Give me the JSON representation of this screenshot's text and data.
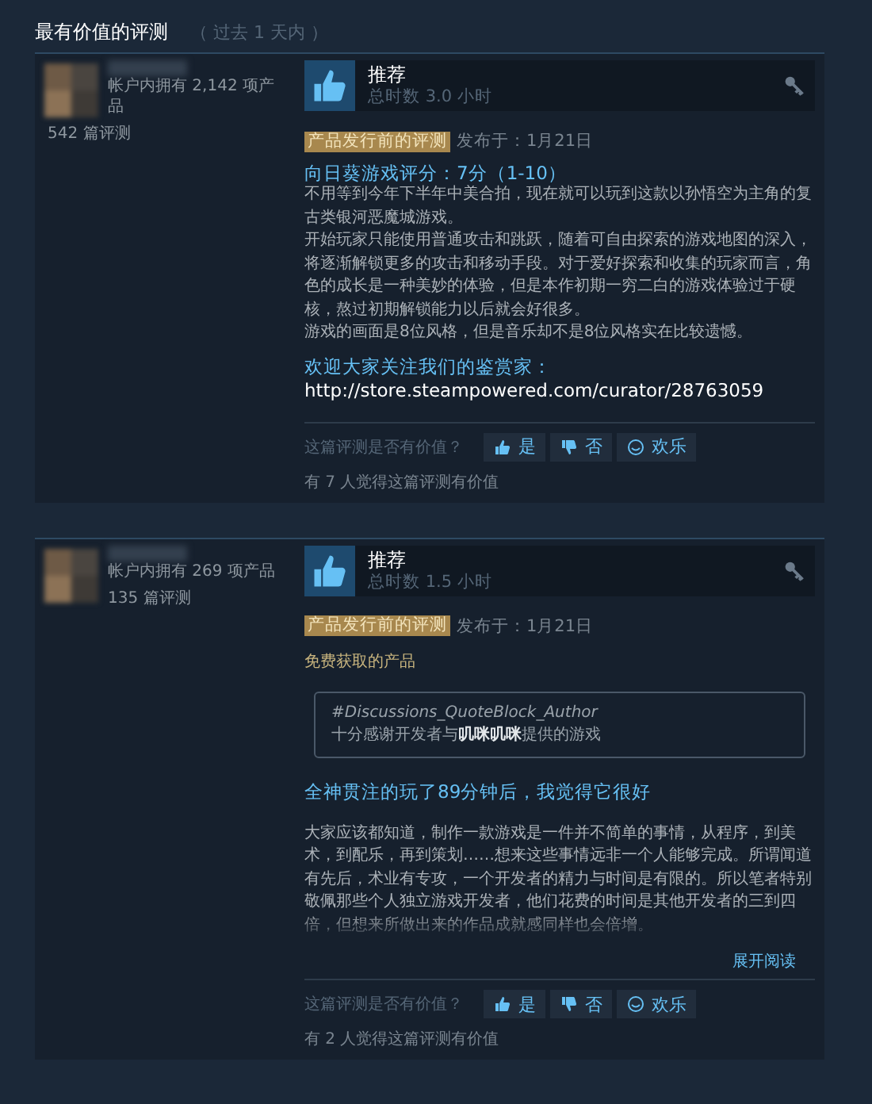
{
  "section": {
    "title": "最有价值的评测",
    "period": "（ 过去 1 天内 ）"
  },
  "reviews": [
    {
      "author": {
        "products": "帐户内拥有 2,142 项产品",
        "reviews": "542 篇评测"
      },
      "verdict": "推荐",
      "recommended": true,
      "hours": "总时数 3.0 小时",
      "tag": "产品发行前的评测",
      "posted": "发布于：1月21日",
      "blocks": [
        {
          "kind": "rating",
          "text": "向日葵游戏评分：7分（1-10）"
        },
        {
          "kind": "text",
          "text": "不用等到今年下半年中美合拍，现在就可以玩到这款以孙悟空为主角的复古类银河恶魔城游戏。"
        },
        {
          "kind": "text",
          "text": "开始玩家只能使用普通攻击和跳跃，随着可自由探索的游戏地图的深入，将逐渐解锁更多的攻击和移动手段。对于爱好探索和收集的玩家而言，角色的成长是一种美妙的体验，但是本作初期一穷二白的游戏体验过于硬核，熬过初期解锁能力以后就会好很多。"
        },
        {
          "kind": "text",
          "text": "游戏的画面是8位风格，但是音乐却不是8位风格实在比较遗憾。"
        },
        {
          "kind": "rating",
          "text": "欢迎大家关注我们的鉴赏家："
        },
        {
          "kind": "url",
          "text": "http://store.steampowered.com/curator/28763059"
        }
      ],
      "helpful_prompt": "这篇评测是否有价值？",
      "votes": [
        "是",
        "否",
        "欢乐"
      ],
      "helpful_count": "有 7 人觉得这篇评测有价值"
    },
    {
      "author": {
        "products": "帐户内拥有 269 项产品",
        "reviews": "135 篇评测"
      },
      "verdict": "推荐",
      "recommended": true,
      "hours": "总时数 1.5 小时",
      "tag": "产品发行前的评测",
      "posted": "发布于：1月21日",
      "blocks": [
        {
          "kind": "free",
          "text": "免费获取的产品"
        },
        {
          "kind": "quote",
          "author": "#Discussions_QuoteBlock_Author",
          "text": "十分感谢开发者与**叽咪叽咪**提供的游戏"
        },
        {
          "kind": "headline",
          "text": "全神贯注的玩了89分钟后，我觉得它很好"
        },
        {
          "kind": "faded",
          "text": "大家应该都知道，制作一款游戏是一件并不简单的事情，从程序，到美术，到配乐，再到策划……想来这些事情远非一个人能够完成。所谓闻道有先后，术业有专攻，一个开发者的精力与时间是有限的。所以笔者特别敬佩那些个人独立游戏开发者，他们花费的时间是其他开发者的三到四倍，但想来所做出来的作品成就感同样也会倍增。"
        }
      ],
      "read_more": "展开阅读",
      "helpful_prompt": "这篇评测是否有价值？",
      "votes": [
        "是",
        "否",
        "欢乐"
      ],
      "helpful_count": "有 2 人觉得这篇评测有价值"
    }
  ]
}
